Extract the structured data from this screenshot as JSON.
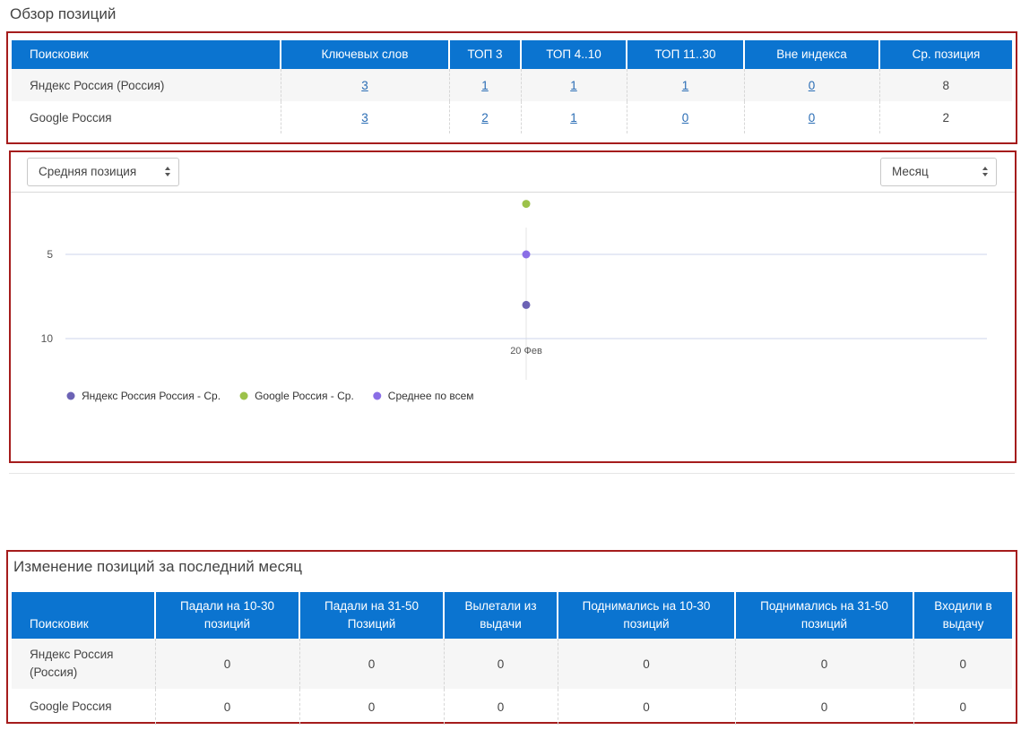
{
  "page_title": "Обзор позиций",
  "overview": {
    "headers": [
      "Поисковик",
      "Ключевых слов",
      "ТОП 3",
      "ТОП 4..10",
      "ТОП 11..30",
      "Вне индекса",
      "Ср. позиция"
    ],
    "rows": [
      {
        "engine": "Яндекс Россия (Россия)",
        "keywords": "3",
        "top3": "1",
        "top4_10": "1",
        "top11_30": "1",
        "out_of_index": "0",
        "avg_position": "8"
      },
      {
        "engine": "Google Россия",
        "keywords": "3",
        "top3": "2",
        "top4_10": "1",
        "top11_30": "0",
        "out_of_index": "0",
        "avg_position": "2"
      }
    ]
  },
  "chart_controls": {
    "metric_select": "Средняя позиция",
    "period_select": "Месяц"
  },
  "chart_data": {
    "type": "scatter",
    "x": [
      "20 Фев"
    ],
    "y_ticks": [
      "5",
      "10"
    ],
    "ylim": [
      10,
      2
    ],
    "y_reversed": true,
    "grid": true,
    "legend_position": "bottom-left",
    "series": [
      {
        "name": "Яндекс Россия Россия - Ср.",
        "color": "#6c63b5",
        "values": [
          8
        ]
      },
      {
        "name": "Google Россия - Ср.",
        "color": "#9cc24a",
        "values": [
          2
        ]
      },
      {
        "name": "Среднее по всем",
        "color": "#8a6ee6",
        "values": [
          5
        ]
      }
    ]
  },
  "changes": {
    "title": "Изменение позиций за последний месяц",
    "headers": [
      "Поисковик",
      "Падали на 10-30 позиций",
      "Падали на 31-50 Позиций",
      "Вылетали из выдачи",
      "Поднимались на 10-30 позиций",
      "Поднимались на 31-50 позиций",
      "Входили в выдачу"
    ],
    "rows": [
      {
        "engine": "Яндекс Россия (Россия)",
        "fell_10_30": "0",
        "fell_31_50": "0",
        "dropped_out": "0",
        "rose_10_30": "0",
        "rose_31_50": "0",
        "entered": "0"
      },
      {
        "engine": "Google Россия",
        "fell_10_30": "0",
        "fell_31_50": "0",
        "dropped_out": "0",
        "rose_10_30": "0",
        "rose_31_50": "0",
        "entered": "0"
      }
    ]
  }
}
